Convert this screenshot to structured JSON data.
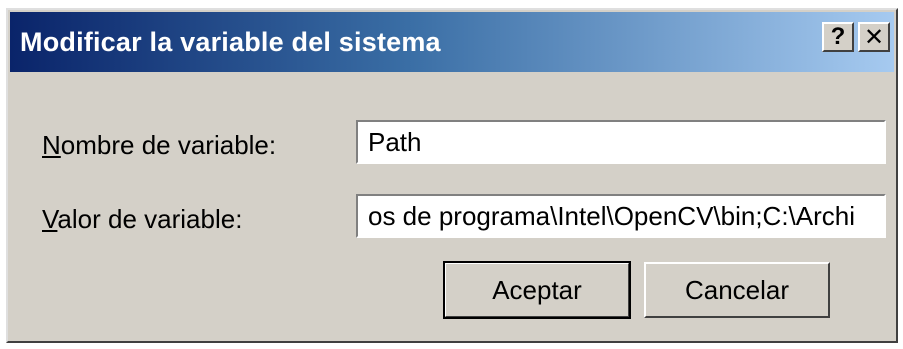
{
  "window": {
    "title": "Modificar la variable del sistema",
    "help_label": "?",
    "close_label": "✕"
  },
  "form": {
    "name_label_mnemonic": "N",
    "name_label_rest": "ombre de variable:",
    "name_value": "Path",
    "value_label_mnemonic": "V",
    "value_label_rest": "alor de variable:",
    "value_value": "os de programa\\Intel\\OpenCV\\bin;C:\\Archi"
  },
  "buttons": {
    "accept_label": "Aceptar",
    "cancel_label": "Cancelar"
  },
  "colors": {
    "titlebar_start": "#0a246a",
    "titlebar_end": "#a6caf0",
    "face": "#d4d0c8"
  }
}
